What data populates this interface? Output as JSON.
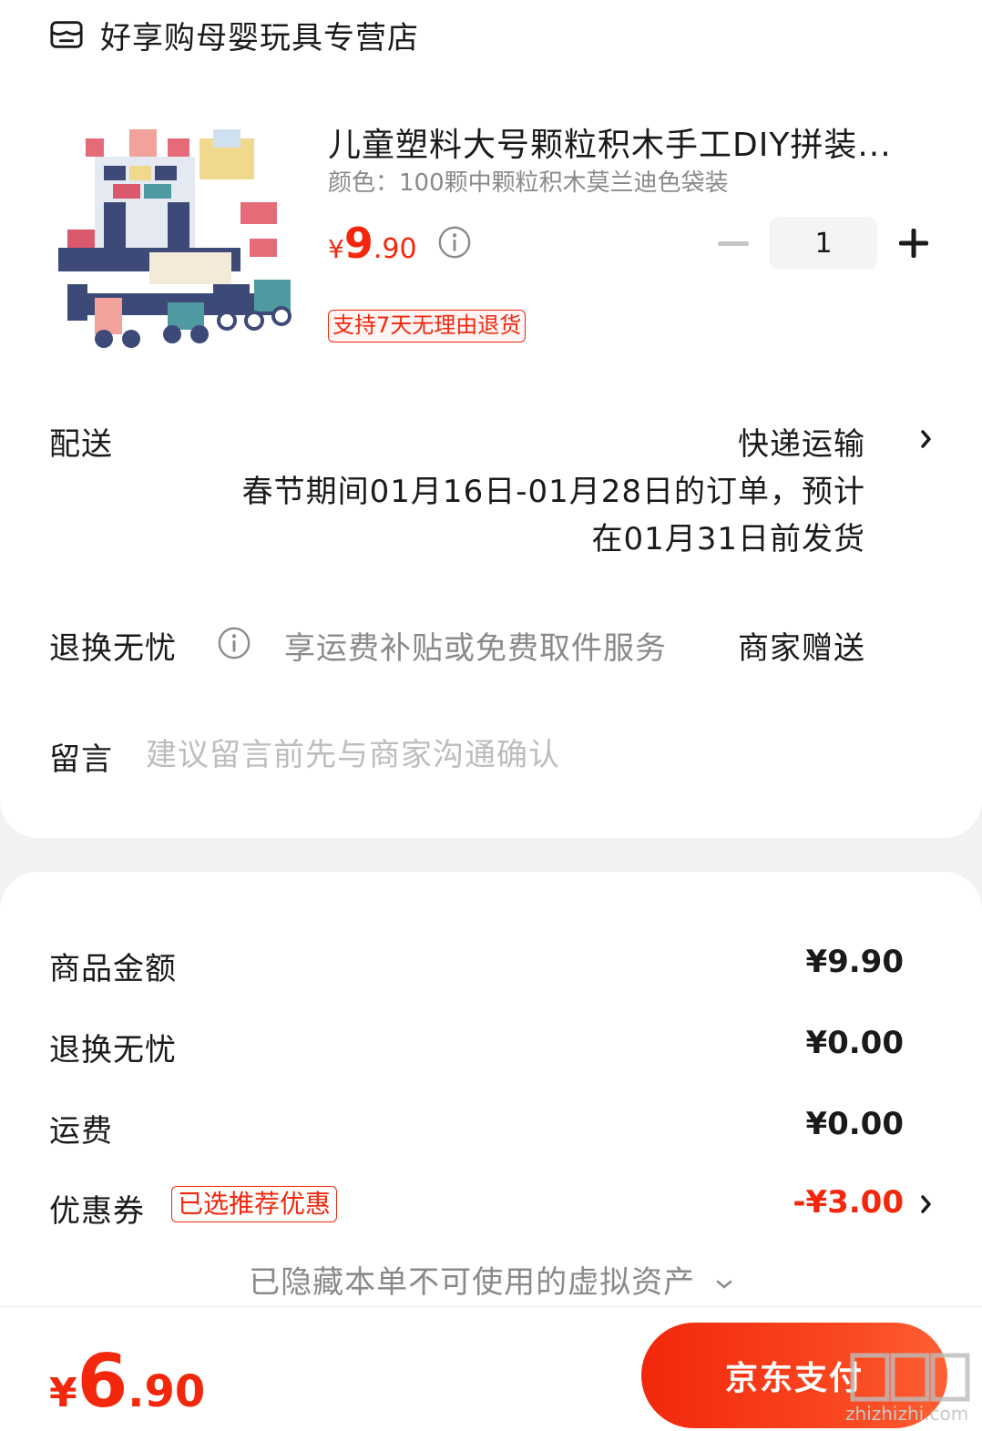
{
  "store": {
    "name": "好享购母婴玩具专营店",
    "icon": "store-icon"
  },
  "product": {
    "title": "儿童塑料大号颗粒积木手工DIY拼装...",
    "spec": "颜色：100颗中颗粒积木莫兰迪色袋装",
    "price": {
      "currency": "¥",
      "integer": "9",
      "decimal": ".90"
    },
    "quantity": "1",
    "tag": "支持7天无理由退货"
  },
  "shipping": {
    "label": "配送",
    "method": "快递运输",
    "note_line1": "春节期间01月16日-01月28日的订单，预计",
    "note_line2": "在01月31日前发货"
  },
  "return_service": {
    "label": "退换无忧",
    "desc": "享运费补贴或免费取件服务",
    "gift": "商家赠送"
  },
  "message": {
    "label": "留言",
    "placeholder": "建议留言前先与商家沟通确认"
  },
  "summary": {
    "goods": {
      "label": "商品金额",
      "value": "¥9.90"
    },
    "return": {
      "label": "退换无忧",
      "value": "¥0.00"
    },
    "freight": {
      "label": "运费",
      "value": "¥0.00"
    },
    "coupon": {
      "label": "优惠券",
      "tag": "已选推荐优惠",
      "value": "-¥3.00"
    },
    "hidden_assets": "已隐藏本单不可使用的虚拟资产"
  },
  "footer": {
    "total": {
      "currency": "¥",
      "integer": "6",
      "decimal": ".90"
    },
    "pay_button": "京东支付",
    "watermark_text": "zhizhizhi.com"
  },
  "colors": {
    "accent": "#f2270c",
    "muted": "#8a8a8a",
    "placeholder": "#bdbdbd"
  }
}
